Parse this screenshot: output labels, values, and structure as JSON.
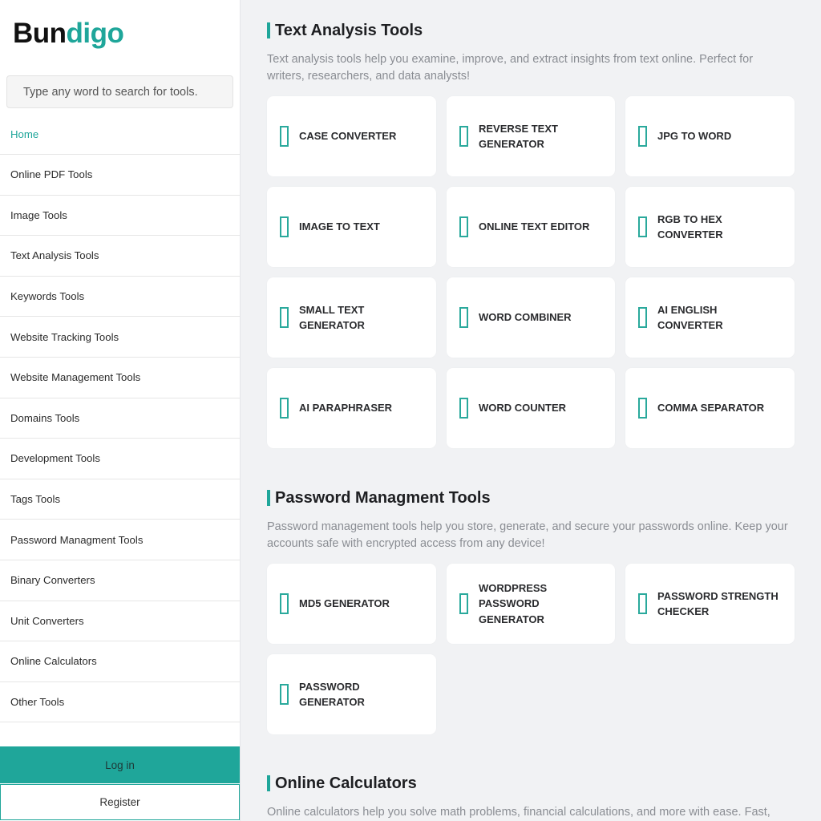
{
  "brand": {
    "part1": "Bun",
    "part2": "digo",
    "accent": "#1fa69a"
  },
  "search": {
    "placeholder": "Type any word to search for tools."
  },
  "sidebar": {
    "items": [
      {
        "label": "Home",
        "active": true
      },
      {
        "label": "Online PDF Tools"
      },
      {
        "label": "Image Tools"
      },
      {
        "label": "Text Analysis Tools"
      },
      {
        "label": "Keywords Tools"
      },
      {
        "label": "Website Tracking Tools"
      },
      {
        "label": "Website Management Tools"
      },
      {
        "label": "Domains Tools"
      },
      {
        "label": "Development Tools"
      },
      {
        "label": "Tags Tools"
      },
      {
        "label": "Password Managment Tools"
      },
      {
        "label": "Binary Converters"
      },
      {
        "label": "Unit Converters"
      },
      {
        "label": "Online Calculators"
      },
      {
        "label": "Other Tools"
      }
    ],
    "login_label": "Log in",
    "register_label": "Register"
  },
  "sections": [
    {
      "title": "Text Analysis Tools",
      "description": "Text analysis tools help you examine, improve, and extract insights from text online. Perfect for writers, researchers, and data analysts!",
      "tools": [
        {
          "label": "CASE CONVERTER",
          "icon": "missing-glyph-icon"
        },
        {
          "label": "REVERSE TEXT GENERATOR",
          "icon": "missing-glyph-icon"
        },
        {
          "label": "JPG TO WORD",
          "icon": "missing-glyph-icon"
        },
        {
          "label": "IMAGE TO TEXT",
          "icon": "missing-glyph-icon"
        },
        {
          "label": "ONLINE TEXT EDITOR",
          "icon": "missing-glyph-icon"
        },
        {
          "label": "RGB TO HEX CONVERTER",
          "icon": "missing-glyph-icon"
        },
        {
          "label": "SMALL TEXT GENERATOR",
          "icon": "missing-glyph-icon"
        },
        {
          "label": "WORD COMBINER",
          "icon": "missing-glyph-icon"
        },
        {
          "label": "AI ENGLISH CONVERTER",
          "icon": "missing-glyph-icon"
        },
        {
          "label": "AI PARAPHRASER",
          "icon": "missing-glyph-icon"
        },
        {
          "label": "WORD COUNTER",
          "icon": "missing-glyph-icon"
        },
        {
          "label": "COMMA SEPARATOR",
          "icon": "missing-glyph-icon"
        }
      ]
    },
    {
      "title": "Password Managment Tools",
      "description": "Password management tools help you store, generate, and secure your passwords online. Keep your accounts safe with encrypted access from any device!",
      "tools": [
        {
          "label": "MD5 GENERATOR",
          "icon": "missing-glyph-icon"
        },
        {
          "label": "WORDPRESS PASSWORD GENERATOR",
          "icon": "missing-glyph-icon"
        },
        {
          "label": "PASSWORD STRENGTH CHECKER",
          "icon": "missing-glyph-icon"
        },
        {
          "label": "PASSWORD GENERATOR",
          "icon": "missing-glyph-icon"
        }
      ]
    },
    {
      "title": "Online Calculators",
      "description": "Online calculators help you solve math problems, financial calculations, and more with ease. Fast,",
      "tools": []
    }
  ]
}
